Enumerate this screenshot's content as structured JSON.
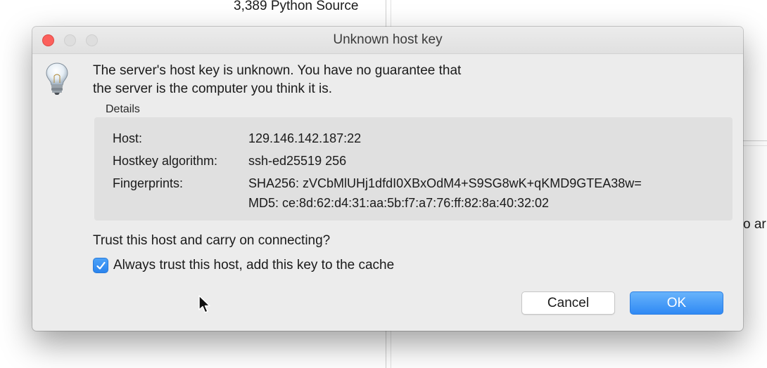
{
  "background": {
    "file_row_text": "3,389  Python Source",
    "side_fragment": "o ar"
  },
  "dialog": {
    "title": "Unknown host key",
    "message_line1": "The server's host key is unknown. You have no guarantee that",
    "message_line2": "the server is the computer you think it is.",
    "details_label": "Details",
    "details": {
      "host_label": "Host:",
      "host_value": "129.146.142.187:22",
      "algorithm_label": "Hostkey algorithm:",
      "algorithm_value": "ssh-ed25519 256",
      "fingerprints_label": "Fingerprints:",
      "fingerprint_sha256": "SHA256: zVCbMlUHj1dfdI0XBxOdM4+S9SG8wK+qKMD9GTEA38w=",
      "fingerprint_md5": "MD5: ce:8d:62:d4:31:aa:5b:f7:a7:76:ff:82:8a:40:32:02"
    },
    "question": "Trust this host and carry on connecting?",
    "checkbox": {
      "label": "Always trust this host, add this key to the cache",
      "checked": true
    },
    "buttons": {
      "cancel": "Cancel",
      "ok": "OK"
    }
  },
  "colors": {
    "accent": "#2f89f4",
    "close_button": "#fc605c",
    "dialog_background": "#ececec"
  }
}
